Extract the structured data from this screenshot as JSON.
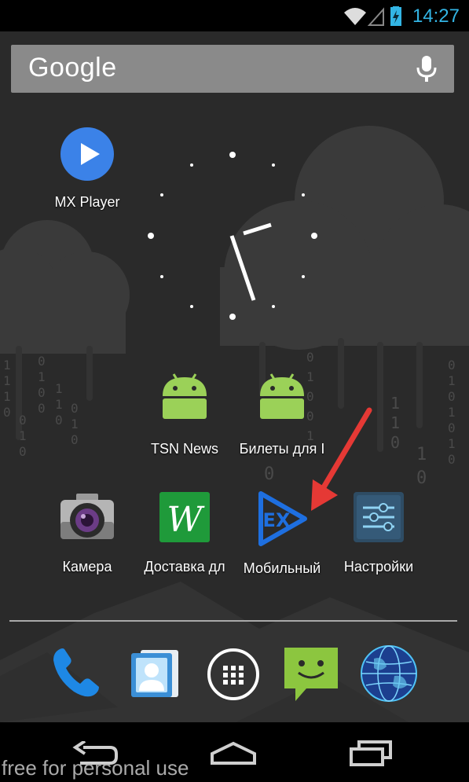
{
  "status_bar": {
    "time": "14:27",
    "icons": [
      "wifi-icon",
      "cell-signal-icon",
      "battery-charging-icon"
    ],
    "accent_color": "#33b5e5"
  },
  "search": {
    "logo_text": "Google",
    "icon": "mic-icon"
  },
  "apps": {
    "mx_player": {
      "label": "MX Player",
      "icon": "mx-player-icon"
    },
    "tsn_news": {
      "label": "TSN News",
      "icon": "android-icon"
    },
    "tickets": {
      "label": "Билеты для I",
      "icon": "android-icon"
    },
    "camera": {
      "label": "Камера",
      "icon": "camera-icon"
    },
    "delivery": {
      "label": "Доставка дл",
      "icon": "delivery-w-icon"
    },
    "mobile_ex": {
      "label": "Мобильный",
      "icon": "ex-icon"
    },
    "settings": {
      "label": "Настройки",
      "icon": "settings-icon"
    }
  },
  "dock": [
    "phone-icon",
    "contacts-icon",
    "app-drawer-icon",
    "messaging-icon",
    "browser-globe-icon"
  ],
  "navbar": [
    "back-icon",
    "home-icon",
    "recents-icon"
  ],
  "annotation": {
    "type": "red-arrow",
    "color": "#e53935",
    "points_to": "Мобильный"
  },
  "watermark": "free for personal use"
}
